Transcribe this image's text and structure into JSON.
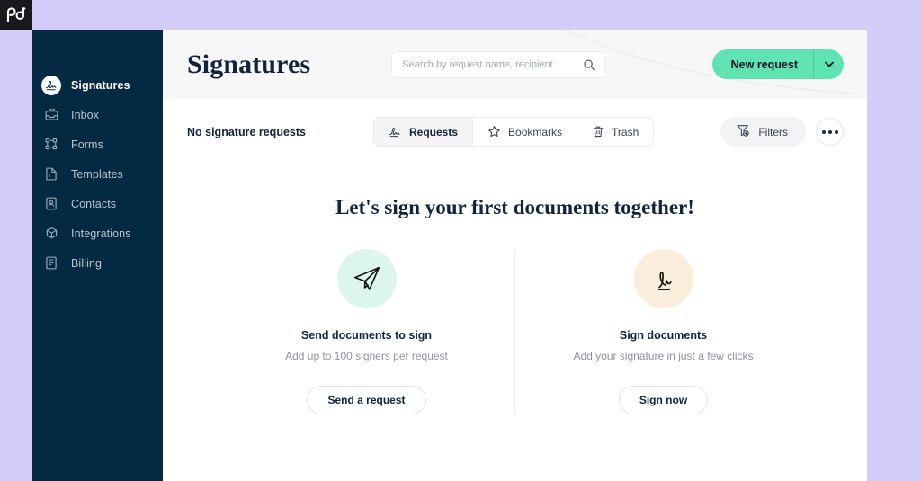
{
  "brand": {
    "logo_text": "pd",
    "logo_mark": "pandadoc-logo"
  },
  "sidebar": {
    "items": [
      {
        "label": "Signatures",
        "icon": "signature-icon",
        "active": true
      },
      {
        "label": "Inbox",
        "icon": "inbox-icon",
        "active": false
      },
      {
        "label": "Forms",
        "icon": "forms-icon",
        "active": false
      },
      {
        "label": "Templates",
        "icon": "template-icon",
        "active": false
      },
      {
        "label": "Contacts",
        "icon": "contacts-icon",
        "active": false
      },
      {
        "label": "Integrations",
        "icon": "integrations-icon",
        "active": false
      },
      {
        "label": "Billing",
        "icon": "billing-icon",
        "active": false
      }
    ]
  },
  "header": {
    "title": "Signatures",
    "search": {
      "value": "",
      "placeholder": "Search by request name, recipient...",
      "icon": "search-icon"
    },
    "new_request": {
      "label": "New request",
      "caret_icon": "chevron-down-icon"
    }
  },
  "toolbar": {
    "empty_label": "No signature requests",
    "tabs": [
      {
        "label": "Requests",
        "icon": "signature-icon",
        "active": true
      },
      {
        "label": "Bookmarks",
        "icon": "star-icon",
        "active": false
      },
      {
        "label": "Trash",
        "icon": "trash-icon",
        "active": false
      }
    ],
    "filters": {
      "label": "Filters",
      "icon": "filter-add-icon"
    },
    "more": {
      "label": "",
      "icon": "more-horizontal-icon"
    }
  },
  "empty_state": {
    "heading": "Let's sign your first documents together!",
    "cards": [
      {
        "icon": "paper-plane-icon",
        "title": "Send documents to sign",
        "subtitle": "Add up to 100 signers per request",
        "button": "Send a request"
      },
      {
        "icon": "signature-scribble-icon",
        "title": "Sign documents",
        "subtitle": "Add your signature in just a few clicks",
        "button": "Sign now"
      }
    ]
  },
  "colors": {
    "page_background": "#d4ccf9",
    "sidebar": "#042942",
    "accent_green": "#5fe3b3",
    "header_background": "#f7f7f8",
    "text_dark": "#13233a",
    "icon_send_bg": "#ddf6ec",
    "icon_sign_bg": "#fbeddb"
  }
}
